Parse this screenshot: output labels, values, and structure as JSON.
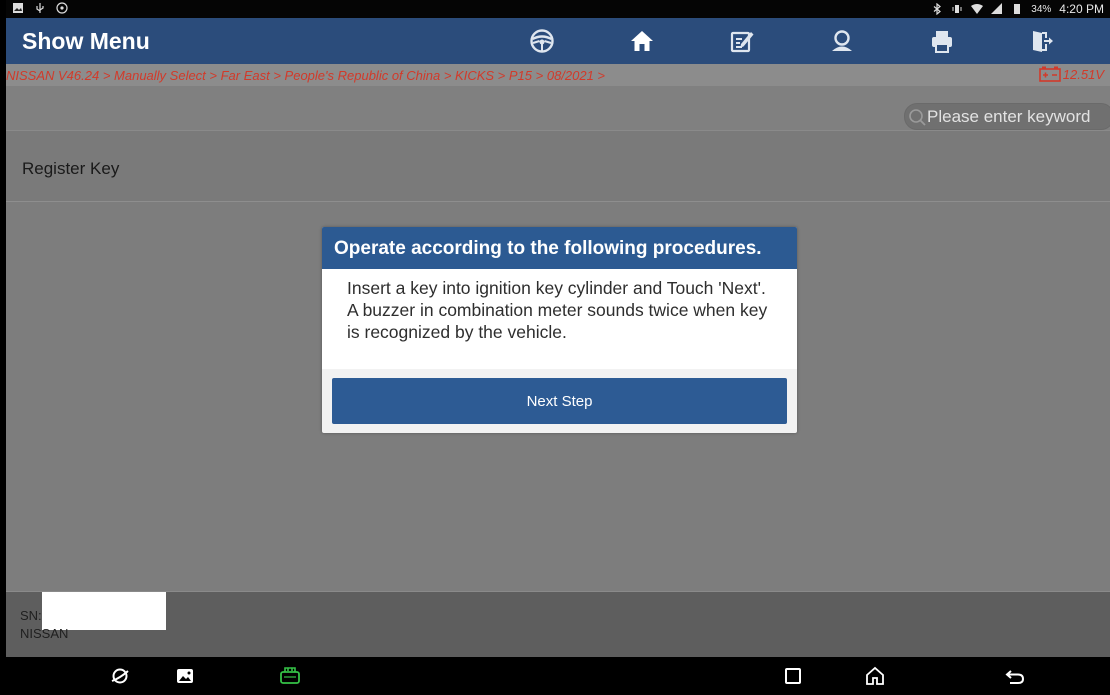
{
  "status_bar": {
    "battery": "34%",
    "time": "4:20 PM"
  },
  "header": {
    "title": "Show Menu",
    "buttons": [
      "steering-wheel-icon",
      "home-icon",
      "edit-report-icon",
      "user-icon",
      "print-icon",
      "exit-icon"
    ]
  },
  "breadcrumb": {
    "path": "NISSAN V46.24 > Manually Select > Far East > People's Republic of China > KICKS > P15 > 08/2021 >",
    "voltage": "12.51V"
  },
  "search": {
    "placeholder": "Please enter keyword"
  },
  "list": {
    "item": "Register Key"
  },
  "dialog": {
    "title": "Operate according to the following procedures.",
    "message": "Insert a key into ignition key cylinder and Touch 'Next'. A buzzer in combination meter sounds twice when key is recognized by the vehicle.",
    "button": "Next Step"
  },
  "footer": {
    "sn_label": "SN:",
    "maker": "NISSAN"
  },
  "colors": {
    "header": "#2b4c7b",
    "accent_red": "#d23a2a",
    "dialog_title": "#2c5a92",
    "vci_green": "#35c247"
  }
}
